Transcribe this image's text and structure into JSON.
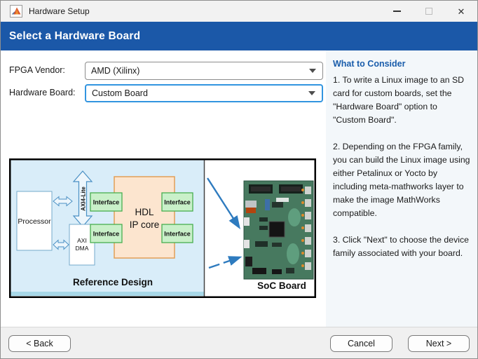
{
  "window": {
    "title": "Hardware Setup",
    "controls": {
      "close": "✕"
    }
  },
  "header": {
    "title": "Select a Hardware Board"
  },
  "form": {
    "fpga_vendor": {
      "label": "FPGA Vendor:",
      "value": "AMD (Xilinx)"
    },
    "hardware_board": {
      "label": "Hardware Board:",
      "value": "Custom Board"
    }
  },
  "diagram": {
    "processor": "Processor",
    "axi4_lite": "AXI4-Lite",
    "axi_dma_line1": "AXI",
    "axi_dma_line2": "DMA",
    "hdl_line1": "HDL",
    "hdl_line2": "IP core",
    "interface": "Interface",
    "reference_design": "Reference Design",
    "soc_board": "SoC Board"
  },
  "sidebar": {
    "title": "What to Consider",
    "paragraphs": [
      "1. To write a Linux image to an SD card for custom boards, set the \"Hardware Board\" option to \"Custom Board\".",
      "2. Depending on the FPGA family, you can build the Linux image using either Petalinux or Yocto by including meta-mathworks layer to make the image MathWorks compatible.",
      "3. Click \"Next\" to choose the device family associated with your board."
    ]
  },
  "footer": {
    "back": "< Back",
    "cancel": "Cancel",
    "next": "Next >"
  },
  "colors": {
    "header_blue": "#1b58a8",
    "focus_border": "#3295e0",
    "arrow_blue": "#2e7bbf"
  }
}
